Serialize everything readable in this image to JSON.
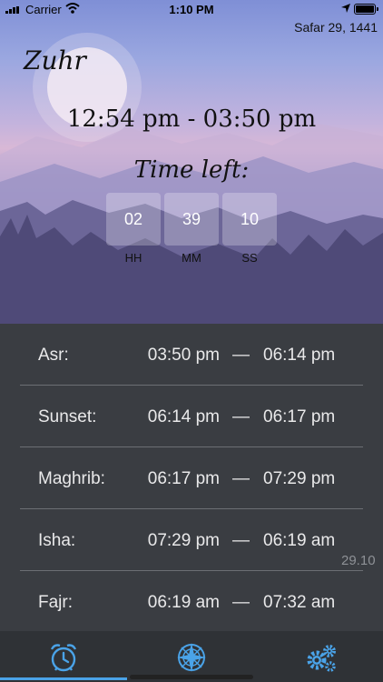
{
  "status_bar": {
    "carrier": "Carrier",
    "time": "1:10 PM"
  },
  "header": {
    "hijri_date": "Safar 29, 1441",
    "current_prayer": "Zuhr",
    "time_range": "12:54 pm - 03:50 pm",
    "time_left_label": "Time left:"
  },
  "countdown": [
    {
      "value": "02",
      "unit": "HH"
    },
    {
      "value": "39",
      "unit": "MM"
    },
    {
      "value": "10",
      "unit": "SS"
    }
  ],
  "prayers": [
    {
      "name": "Asr:",
      "start": "03:50 pm",
      "dash": "—",
      "end": "06:14 pm"
    },
    {
      "name": "Sunset:",
      "start": "06:14 pm",
      "dash": "—",
      "end": "06:17 pm"
    },
    {
      "name": "Maghrib:",
      "start": "06:17 pm",
      "dash": "—",
      "end": "07:29 pm"
    },
    {
      "name": "Isha:",
      "start": "07:29 pm",
      "dash": "—",
      "end": "06:19 am"
    },
    {
      "name": "Fajr:",
      "start": "06:19 am",
      "dash": "—",
      "end": "07:32 am"
    }
  ],
  "side_value": "29.10",
  "tabs": [
    {
      "icon": "alarm-clock-icon",
      "active": true
    },
    {
      "icon": "compass-icon",
      "active": false
    },
    {
      "icon": "gears-icon",
      "active": false
    }
  ],
  "colors": {
    "accent": "#4aa3e8",
    "list_bg": "#3a3d42",
    "tabbar_bg": "#2f3236"
  }
}
